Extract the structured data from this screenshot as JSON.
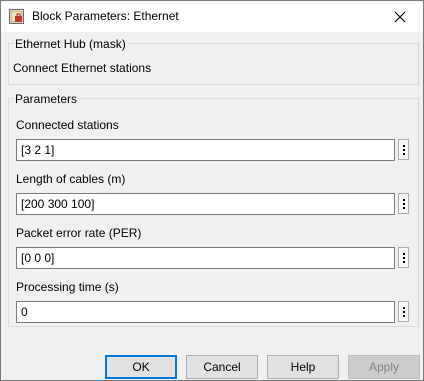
{
  "window": {
    "title": "Block Parameters: Ethernet",
    "icon": "simulink-block-icon",
    "close_icon": "close-icon"
  },
  "mask": {
    "header": "Ethernet Hub (mask)",
    "description": "Connect Ethernet stations"
  },
  "parameters": {
    "header": "Parameters",
    "fields": [
      {
        "label": "Connected stations",
        "value": "[3 2 1]"
      },
      {
        "label": "Length of cables (m)",
        "value": "[200 300 100]"
      },
      {
        "label": "Packet error rate (PER)",
        "value": "[0 0 0]"
      },
      {
        "label": "Processing time (s)",
        "value": "0"
      }
    ]
  },
  "buttons": {
    "ok": "OK",
    "cancel": "Cancel",
    "help": "Help",
    "apply": "Apply"
  },
  "colors": {
    "accent": "#0078d7",
    "dialog_bg": "#f0f0f0"
  }
}
